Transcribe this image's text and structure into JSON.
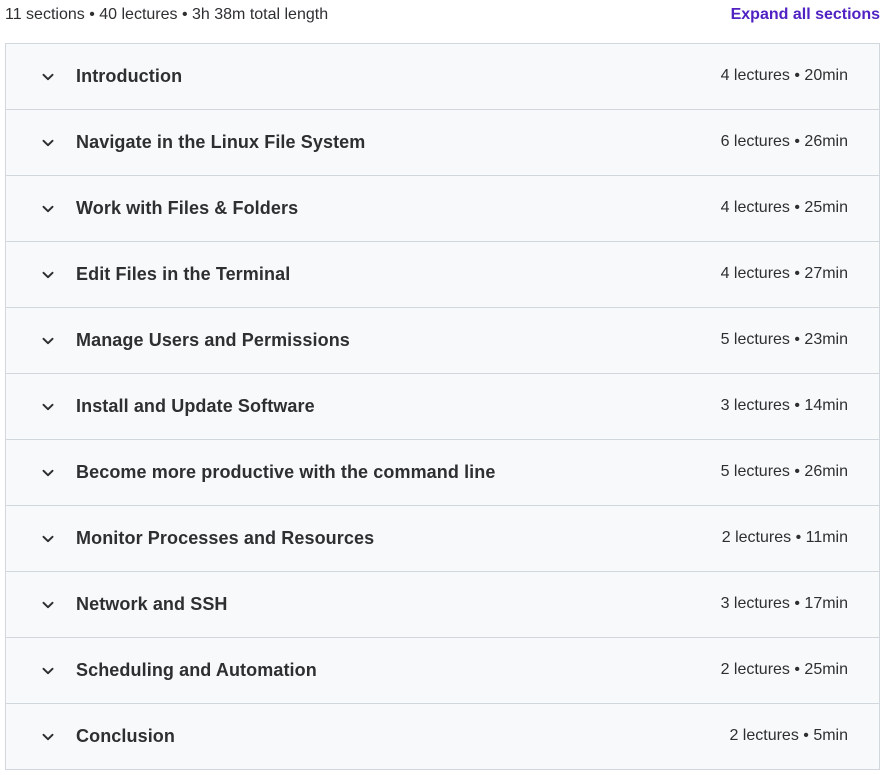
{
  "summary": {
    "text": "11 sections • 40 lectures • 3h 38m total length",
    "expand_label": "Expand all sections"
  },
  "icons": {
    "section_toggle": "chevron-down-icon"
  },
  "colors": {
    "accent": "#5022c3",
    "row_background": "#f7f9fa",
    "border": "#d1d7dc",
    "text": "#2d2f31"
  },
  "sections": [
    {
      "title": "Introduction",
      "meta": "4 lectures • 20min"
    },
    {
      "title": "Navigate in the Linux File System",
      "meta": "6 lectures • 26min"
    },
    {
      "title": "Work with Files & Folders",
      "meta": "4 lectures • 25min"
    },
    {
      "title": "Edit Files in the Terminal",
      "meta": "4 lectures • 27min"
    },
    {
      "title": "Manage Users and Permissions",
      "meta": "5 lectures • 23min"
    },
    {
      "title": "Install and Update Software",
      "meta": "3 lectures • 14min"
    },
    {
      "title": "Become more productive with the command line",
      "meta": "5 lectures • 26min"
    },
    {
      "title": "Monitor Processes and Resources",
      "meta": "2 lectures • 11min"
    },
    {
      "title": "Network and SSH",
      "meta": "3 lectures • 17min"
    },
    {
      "title": "Scheduling and Automation",
      "meta": "2 lectures • 25min"
    },
    {
      "title": "Conclusion",
      "meta": "2 lectures • 5min"
    }
  ]
}
